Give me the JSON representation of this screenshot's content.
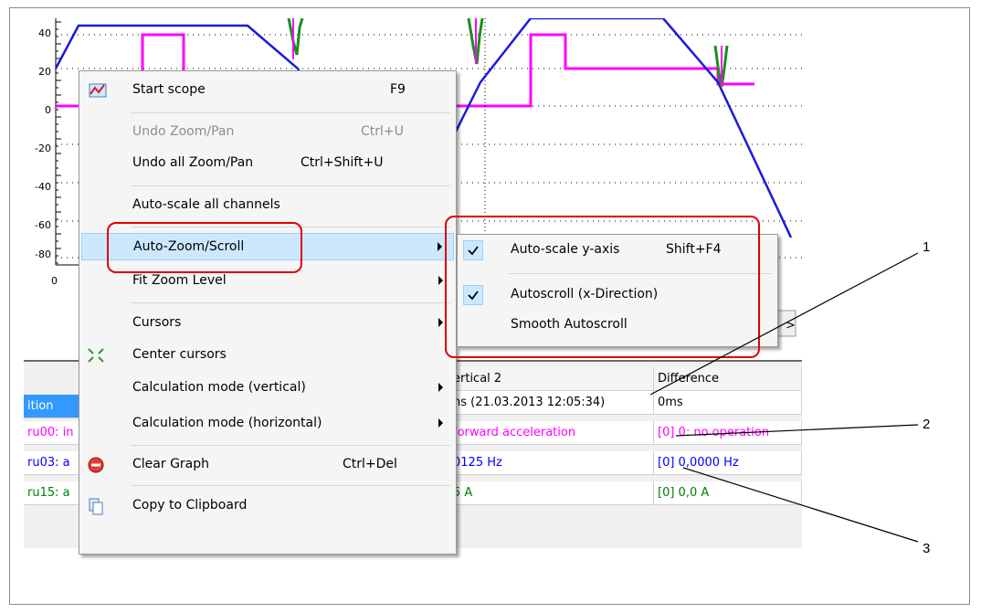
{
  "chart": {
    "y_ticks": [
      "40",
      "20",
      "0",
      "-20",
      "-40",
      "-60",
      "-80"
    ],
    "x_tick": "0",
    "colors": {
      "blue": "#1a1adb",
      "magenta": "#ff00ff",
      "green": "#1a8f1a"
    }
  },
  "table": {
    "header": {
      "position": "ition",
      "vertical2": "ertical 2",
      "difference": "Difference"
    },
    "row_time": {
      "vertical2": "ns (21.03.2013 12:05:34)",
      "difference": "0ms"
    },
    "rows": [
      {
        "name": "ru00: in",
        "vertical2": " forward acceleration",
        "difference": "[0] 0: no operation",
        "color": "#ff00ff"
      },
      {
        "name": "ru03: a",
        "vertical2": "0125 Hz",
        "difference": "[0] 0,0000 Hz",
        "color": "#0000ff"
      },
      {
        "name": "ru15: a",
        "vertical2": "5 A",
        "difference": "[0] 0,0 A",
        "color": "#008000"
      }
    ]
  },
  "context_menu": {
    "items": [
      {
        "label": "Start scope",
        "shortcut": "F9",
        "icon": "scope-chart-icon"
      },
      {
        "label": "Undo Zoom/Pan",
        "shortcut": "Ctrl+U",
        "disabled": true
      },
      {
        "label": "Undo all Zoom/Pan",
        "shortcut": "Ctrl+Shift+U"
      },
      {
        "label": "Auto-scale all channels"
      },
      {
        "label": "Auto-Zoom/Scroll",
        "submenu": true
      },
      {
        "label": "Fit Zoom Level",
        "submenu": true
      },
      {
        "label": "Cursors",
        "submenu": true
      },
      {
        "label": "Center cursors",
        "icon": "center-cursors-icon"
      },
      {
        "label": "Calculation mode (vertical)",
        "submenu": true
      },
      {
        "label": "Calculation mode (horizontal)",
        "submenu": true
      },
      {
        "label": "Clear Graph",
        "shortcut": "Ctrl+Del",
        "icon": "clear-graph-icon"
      },
      {
        "label": "Copy to Clipboard",
        "icon": "copy-clipboard-icon"
      }
    ]
  },
  "submenu": {
    "items": [
      {
        "label": "Auto-scale y-axis",
        "shortcut": "Shift+F4",
        "checked": true
      },
      {
        "label": "Autoscroll (x-Direction)",
        "checked": true
      },
      {
        "label": "Smooth Autoscroll",
        "checked": false
      }
    ]
  },
  "callouts": [
    "1",
    "2",
    "3"
  ]
}
